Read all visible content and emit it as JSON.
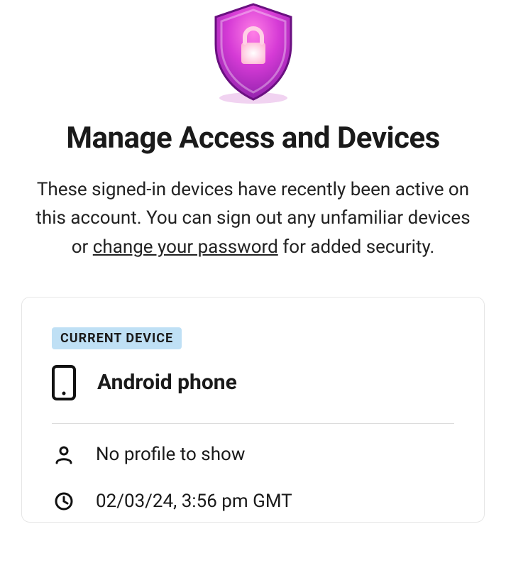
{
  "header": {
    "title": "Manage Access and Devices",
    "description_before": "These signed-in devices have recently been active on this account. You can sign out any unfamiliar devices or ",
    "change_password_link": "change your password",
    "description_after": " for added security."
  },
  "device_card": {
    "badge": "CURRENT DEVICE",
    "device_name": "Android phone",
    "profile_text": "No profile to show",
    "timestamp": "02/03/24, 3:56 pm GMT"
  }
}
